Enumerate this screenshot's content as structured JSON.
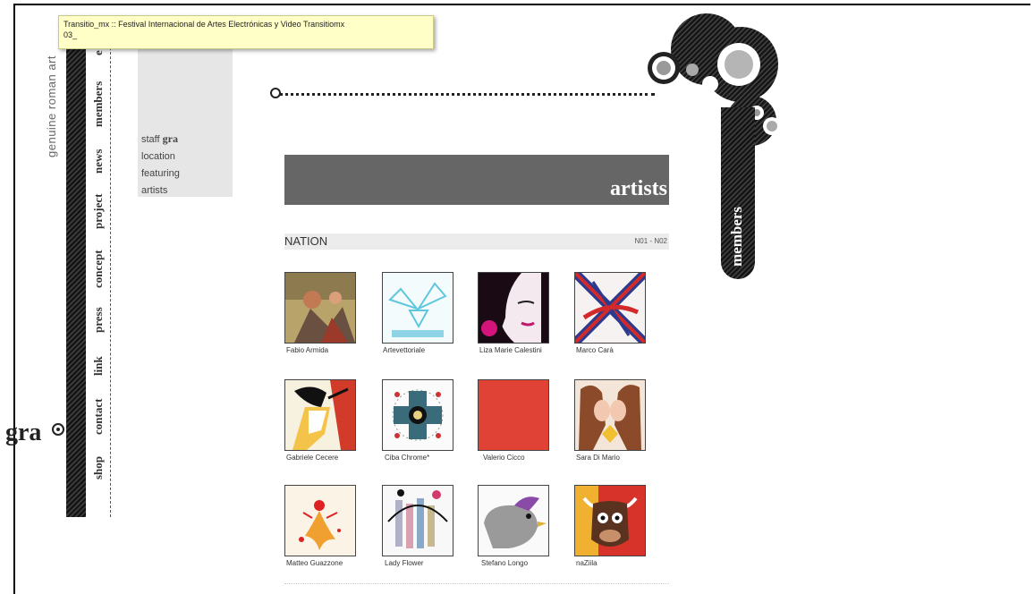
{
  "tooltip": {
    "line1": "Transitio_mx :: Festival Internacional de Artes Electrónicas y Video Transitiomx",
    "line2": "03_"
  },
  "site": {
    "tagline": "genuine roman art",
    "logo_text": "gra"
  },
  "nav": {
    "items": [
      "shop",
      "contact",
      "link",
      "press",
      "concept",
      "project",
      "news",
      "members",
      "e"
    ]
  },
  "submenu": {
    "items": [
      {
        "label": "staff",
        "mark": "gra"
      },
      {
        "label": "location"
      },
      {
        "label": "featuring"
      },
      {
        "label": "artists"
      }
    ]
  },
  "members_tab": {
    "label": "members"
  },
  "section": {
    "title": "artists",
    "group_label": "NATION",
    "range": "N01 - N02"
  },
  "artists": [
    {
      "name": "Fabio Armida",
      "icon": "painting-figures-image"
    },
    {
      "name": "Artevettoriale",
      "icon": "winged-logo-image"
    },
    {
      "name": "Liza Marie Calestini",
      "icon": "face-illustration-image"
    },
    {
      "name": "Marco Carà",
      "icon": "union-jack-image"
    },
    {
      "name": "Gabriele Cecere",
      "icon": "geisha-illustration-image"
    },
    {
      "name": "Ciba Chrome*",
      "icon": "kaleidoscope-image"
    },
    {
      "name": "Valerio Cicco",
      "icon": "red-square-image"
    },
    {
      "name": "Sara Di Mario",
      "icon": "kissing-figures-image"
    },
    {
      "name": "Matteo Guazzone",
      "icon": "abstract-splash-image"
    },
    {
      "name": "Lady Flower",
      "icon": "collage-image"
    },
    {
      "name": "Stefano Longo",
      "icon": "bird-illustration-image"
    },
    {
      "name": "naZiila",
      "icon": "bull-cartoon-image"
    }
  ]
}
